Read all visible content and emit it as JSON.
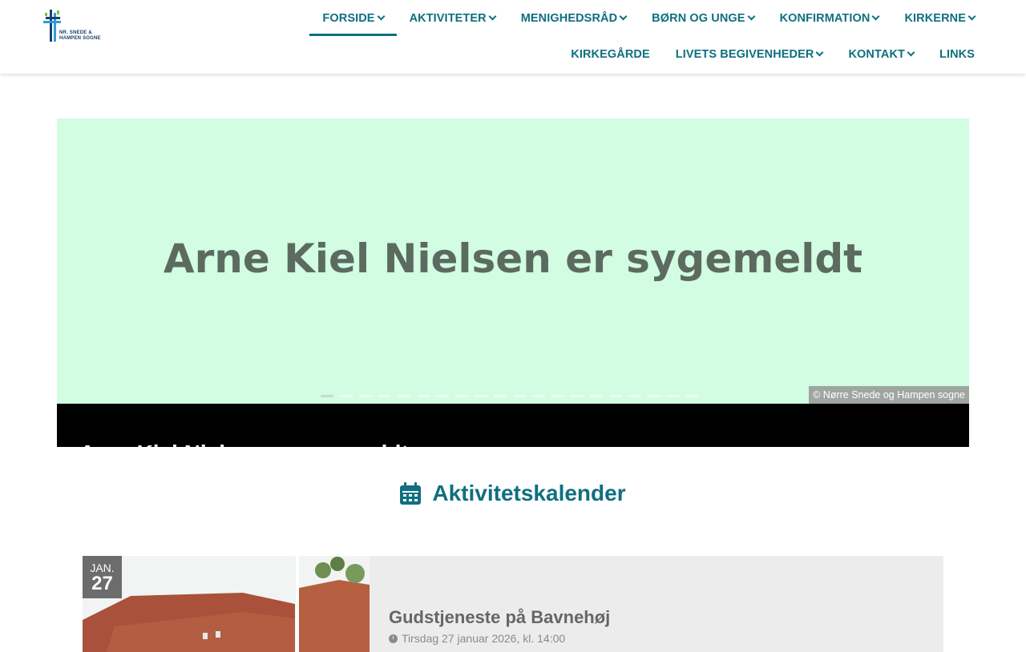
{
  "header": {
    "logo_text": "NR. SNEDE &\nHAMPEN SOGNE",
    "nav_row1": [
      {
        "label": "FORSIDE",
        "dropdown": true,
        "active": true
      },
      {
        "label": "AKTIVITETER",
        "dropdown": true
      },
      {
        "label": "MENIGHEDSRÅD",
        "dropdown": true
      },
      {
        "label": "BØRN OG UNGE",
        "dropdown": true
      },
      {
        "label": "KONFIRMATION",
        "dropdown": true
      },
      {
        "label": "KIRKERNE",
        "dropdown": true
      }
    ],
    "nav_row2": [
      {
        "label": "KIRKEGÅRDE",
        "dropdown": false
      },
      {
        "label": "LIVETS BEGIVENHEDER",
        "dropdown": true
      },
      {
        "label": "KONTAKT",
        "dropdown": true
      },
      {
        "label": "LINKS",
        "dropdown": false
      }
    ]
  },
  "hero": {
    "slide_title": "Arne Kiel Nielsen er sygemeldt",
    "copyright": "© Nørre Snede og Hampen sogne",
    "caption": "Arne Kiel Nielsen er sygemeldt",
    "slide_count": 20,
    "active_slide": 1,
    "background_color": "#d2fde2"
  },
  "calendar": {
    "heading": "Aktivitetskalender",
    "icon": "calendar-icon",
    "events": [
      {
        "month": "JAN.",
        "day": "27",
        "title": "Gudstjeneste på Bavnehøj",
        "time": "Tirsdag 27 januar 2026, kl. 14:00"
      }
    ]
  },
  "colors": {
    "accent": "#0f6f80",
    "caption_bg": "#000000",
    "card_bg": "#ececec"
  }
}
